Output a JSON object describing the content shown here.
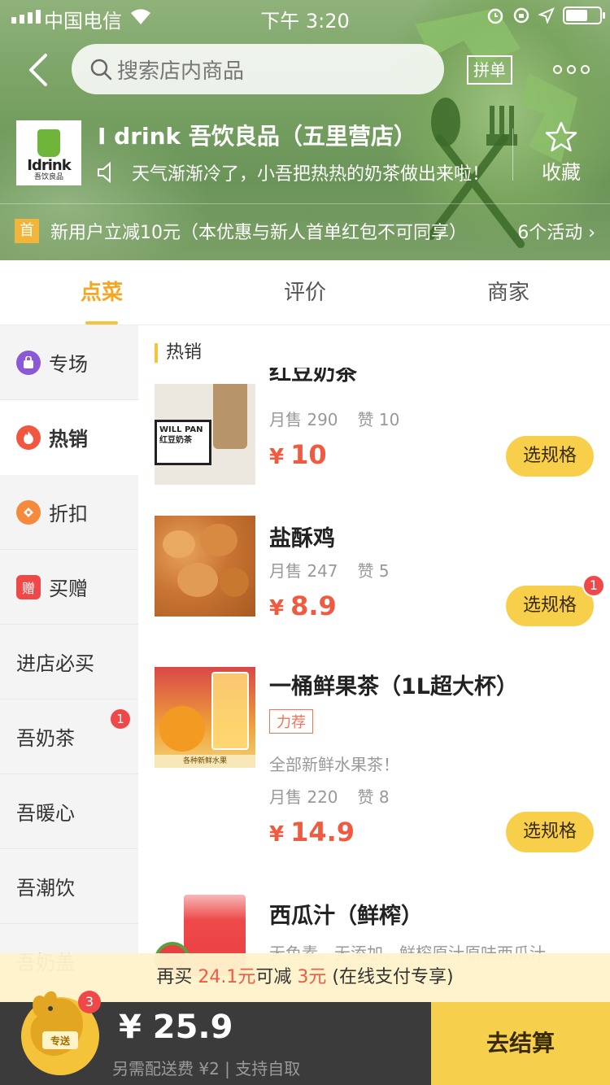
{
  "status_bar": {
    "carrier": "中国电信",
    "time": "下午 3:20"
  },
  "nav": {
    "search_placeholder": "搜索店内商品",
    "group_order": "拼单"
  },
  "shop": {
    "logo_word": "Idrink",
    "logo_sub": "吾饮良品",
    "name": "I drink 吾饮良品（五里营店）",
    "notice": "天气渐渐冷了，小吾把热热的奶茶做出来啦！",
    "favorite_label": "收藏"
  },
  "promo": {
    "tag": "首",
    "text": "新用户立减10元（本优惠与新人首单红包不可同享）",
    "count": "6个活动 ›"
  },
  "tabs": [
    {
      "label": "点菜"
    },
    {
      "label": "评价"
    },
    {
      "label": "商家"
    }
  ],
  "categories": [
    {
      "label": "专场",
      "icon": "shopping-bag-icon",
      "color": "#8b58d8"
    },
    {
      "label": "热销",
      "icon": "flame-icon",
      "color": "#f0573e"
    },
    {
      "label": "折扣",
      "icon": "discount-tag-icon",
      "color": "#f58a3c"
    },
    {
      "label": "买赠",
      "icon": "gift-icon",
      "glyph": "赠",
      "color": "#f04848"
    },
    {
      "label": "进店必买"
    },
    {
      "label": "吾奶茶",
      "badge": "1"
    },
    {
      "label": "吾暖心"
    },
    {
      "label": "吾潮饮"
    },
    {
      "label": "吾奶盖"
    }
  ],
  "section_title": "热销",
  "products": [
    {
      "title": "红豆奶茶",
      "sales": "月售 290",
      "likes": "赞 10",
      "currency": "¥",
      "price": "10",
      "button": "选规格",
      "thumb_text": "WILL PAN 红豆奶茶"
    },
    {
      "title": "盐酥鸡",
      "sales": "月售 247",
      "likes": "赞 5",
      "currency": "¥",
      "price": "8.9",
      "button": "选规格",
      "badge": "1"
    },
    {
      "title": "一桶鲜果茶（1L超大杯）",
      "tag": "力荐",
      "desc": "全部新鲜水果茶！",
      "sales": "月售 220",
      "likes": "赞 8",
      "currency": "¥",
      "price": "14.9",
      "button": "选规格",
      "thumb_text": "各种新鲜水果"
    },
    {
      "title": "西瓜汁（鲜榨）",
      "desc": "无色素，无添加，鲜榨原汁原味西瓜汁"
    }
  ],
  "discount": {
    "prefix": "再买 ",
    "amount": "24.1元",
    "middle": "可减 ",
    "saving": "3元",
    "suffix": " (在线支付专享)"
  },
  "cart": {
    "badge": "3",
    "mascot_label": "专送",
    "total": "¥ 25.9",
    "fee": "另需配送费 ¥2 | 支持自取",
    "checkout": "去结算"
  },
  "colors": {
    "accent": "#f5c339",
    "price": "#f05a40",
    "header_green": "#79a264"
  }
}
